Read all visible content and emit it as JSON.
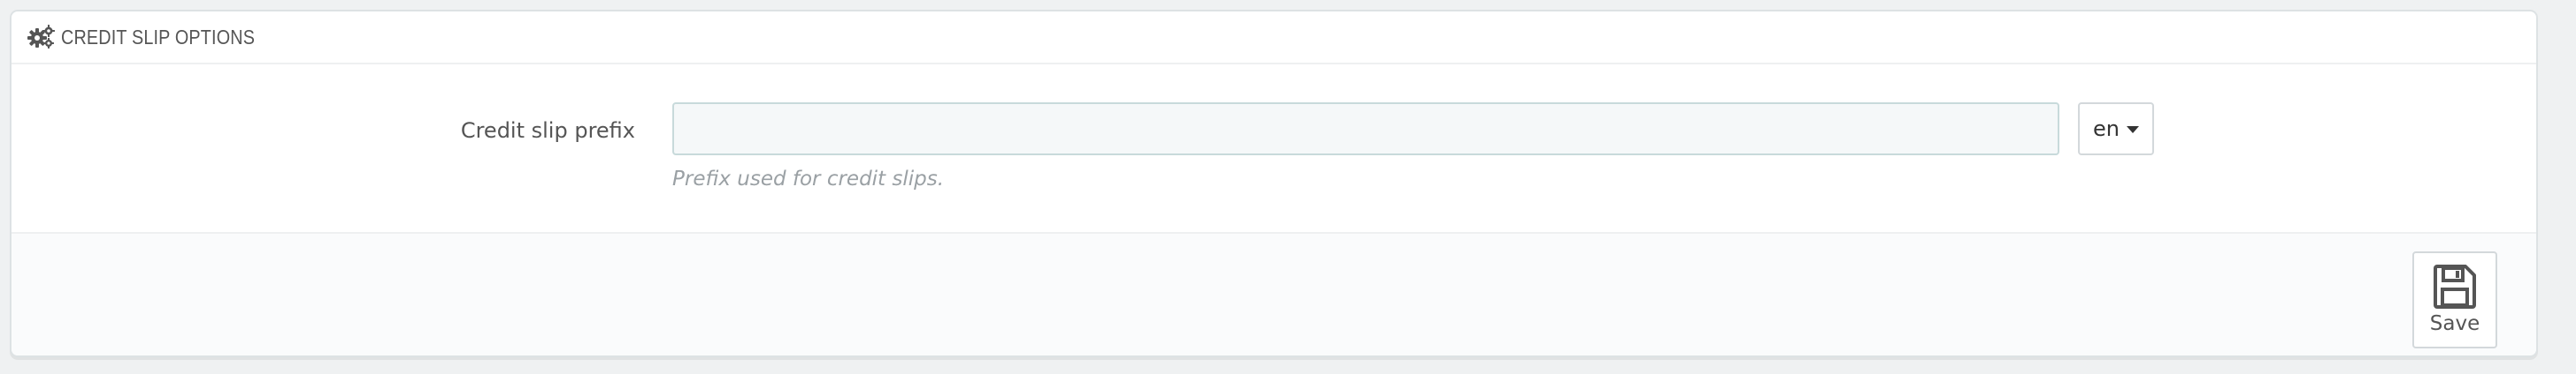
{
  "panel": {
    "heading_icon": "gears-icon",
    "heading_title": "CREDIT SLIP OPTIONS"
  },
  "form": {
    "prefix_label": "Credit slip prefix",
    "prefix_value": "",
    "prefix_placeholder": "",
    "language": "en",
    "language_icon": "caret-down-icon",
    "help_text": "Prefix used for credit slips."
  },
  "footer": {
    "save_icon": "floppy-disk-icon",
    "save_label": "Save"
  }
}
